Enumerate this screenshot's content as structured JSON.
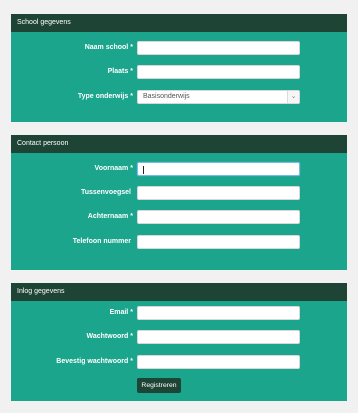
{
  "school": {
    "title": "School gegevens",
    "fields": [
      {
        "label": "Naam school",
        "required": "*",
        "value": ""
      },
      {
        "label": "Plaats",
        "required": "*",
        "value": ""
      }
    ],
    "type_label": "Type onderwijs",
    "type_required": "*",
    "type_value": "Basisonderwijs",
    "type_arrow_icon": "chevron-down-icon"
  },
  "contact": {
    "title": "Contact persoon",
    "fields": [
      {
        "label": "Voornaam",
        "required": "*",
        "value": ""
      },
      {
        "label": "Tussenvoegsel",
        "required": "",
        "value": ""
      },
      {
        "label": "Achternaam",
        "required": "*",
        "value": ""
      },
      {
        "label": "Telefoon nummer",
        "required": "",
        "value": ""
      }
    ]
  },
  "login": {
    "title": "Inlog gegevens",
    "fields": [
      {
        "label": "Email",
        "required": "*",
        "value": ""
      },
      {
        "label": "Wachtwoord",
        "required": "*",
        "value": ""
      },
      {
        "label": "Bevestig wachtwoord",
        "required": "*",
        "value": ""
      }
    ],
    "submit_label": "Registreren"
  },
  "colors": {
    "header": "#1e4436",
    "body": "#1aa58c",
    "page": "#f1f1f1"
  }
}
